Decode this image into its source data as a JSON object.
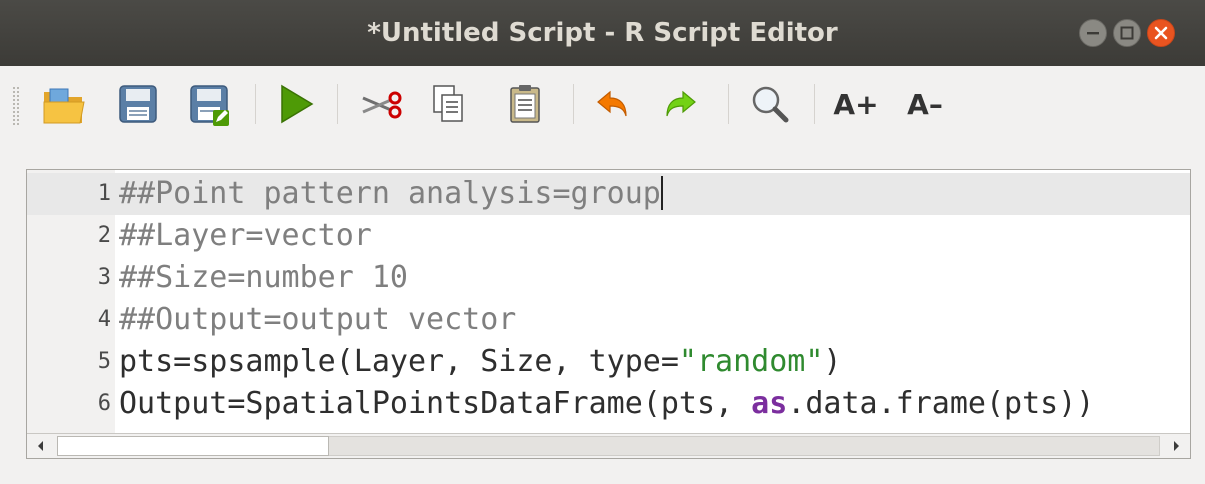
{
  "window": {
    "title": "*Untitled Script - R Script Editor"
  },
  "toolbar": {
    "buttons": [
      {
        "name": "open-script",
        "icon": "folder-open-icon"
      },
      {
        "name": "save-script",
        "icon": "save-icon"
      },
      {
        "name": "save-script-as",
        "icon": "save-as-icon"
      },
      {
        "name": "run-script",
        "icon": "run-play-icon"
      },
      {
        "name": "cut",
        "icon": "scissors-icon"
      },
      {
        "name": "copy",
        "icon": "copy-icon"
      },
      {
        "name": "paste",
        "icon": "paste-icon"
      },
      {
        "name": "undo",
        "icon": "undo-icon"
      },
      {
        "name": "redo",
        "icon": "redo-icon"
      },
      {
        "name": "find-replace",
        "icon": "search-icon"
      }
    ],
    "increase_font_label": "A+",
    "decrease_font_label": "A–"
  },
  "editor": {
    "current_line": 1,
    "lines": [
      {
        "number": "1",
        "tokens": [
          {
            "text": "##Point pattern analysis=group",
            "type": "comment"
          }
        ]
      },
      {
        "number": "2",
        "tokens": [
          {
            "text": "##Layer=vector",
            "type": "comment"
          }
        ]
      },
      {
        "number": "3",
        "tokens": [
          {
            "text": "##Size=number 10",
            "type": "comment"
          }
        ]
      },
      {
        "number": "4",
        "tokens": [
          {
            "text": "##Output=output vector",
            "type": "comment"
          }
        ]
      },
      {
        "number": "5",
        "tokens": [
          {
            "text": "pts=spsample(Layer, Size, type=",
            "type": "default"
          },
          {
            "text": "\"random\"",
            "type": "string"
          },
          {
            "text": ")",
            "type": "default"
          }
        ]
      },
      {
        "number": "6",
        "tokens": [
          {
            "text": "Output=SpatialPointsDataFrame(pts, ",
            "type": "default"
          },
          {
            "text": "as",
            "type": "keyword"
          },
          {
            "text": ".data.frame(pts))",
            "type": "default"
          }
        ]
      }
    ]
  },
  "colors": {
    "titlebar": "#3c3b37",
    "close_button": "#e95420",
    "comment": "#7f7f7f",
    "string": "#2f8a2f",
    "keyword": "#7b2e9e"
  }
}
